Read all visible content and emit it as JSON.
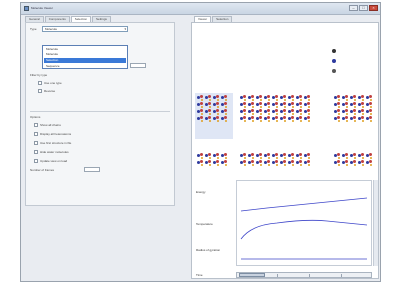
{
  "window": {
    "title": "Molecule Viewer",
    "min": "–",
    "max": "□",
    "close": "×"
  },
  "left": {
    "tabs": [
      "General",
      "Components",
      "Selection",
      "Settings"
    ],
    "active_tab": 2,
    "field1_label": "Type",
    "field1_value": "Molecule",
    "popup": [
      "Molecule",
      "Molecule",
      "Selection",
      "Sequence"
    ],
    "popup_selected": 2,
    "row_label": "Filter by type",
    "checks": [
      "Use one type",
      "Reverse"
    ],
    "section_label": "Options",
    "options": [
      "Show all chains",
      "Display all heteroatoms",
      "Use first structure in file",
      "Hide water molecules",
      "Update view on load"
    ],
    "count_label": "Number of frames"
  },
  "right": {
    "tabs": [
      "Viewer",
      "Selection"
    ],
    "active_tab": 0,
    "plot_labels": [
      "Energy",
      "Temperature",
      "Radius of gyration"
    ],
    "bottom_label": "Time"
  },
  "colors": {
    "accent": "#3a79d7",
    "mol_primary": "#2e3a9e",
    "mol_secondary": "#c04040",
    "plot_line": "#3d45c9"
  }
}
